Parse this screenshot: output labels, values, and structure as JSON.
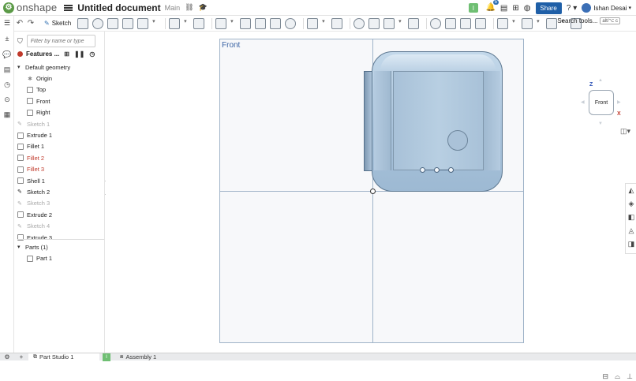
{
  "app": {
    "logo_mark": "⚙",
    "logo_text": "onshape",
    "document_title": "Untitled document",
    "branch": "Main",
    "notifications_count": "5",
    "notification_badge": "I",
    "share_label": "Share",
    "help_icon": "?",
    "user_name": "Ishan Desai"
  },
  "toolbar": {
    "sketch_label": "Sketch",
    "search_tools_label": "Search tools...",
    "search_tools_shortcut": "alt/⌥ c"
  },
  "feature_panel": {
    "filter_placeholder": "Filter by name or type",
    "header_label": "Features ...",
    "tree": [
      {
        "label": "Default geometry",
        "kind": "group",
        "state": "normal"
      },
      {
        "label": "Origin",
        "kind": "origin",
        "state": "normal"
      },
      {
        "label": "Top",
        "kind": "plane",
        "state": "normal"
      },
      {
        "label": "Front",
        "kind": "plane",
        "state": "normal"
      },
      {
        "label": "Right",
        "kind": "plane",
        "state": "normal"
      },
      {
        "label": "Sketch 1",
        "kind": "sketch",
        "state": "muted"
      },
      {
        "label": "Extrude 1",
        "kind": "feature",
        "state": "normal"
      },
      {
        "label": "Fillet 1",
        "kind": "feature",
        "state": "normal"
      },
      {
        "label": "Fillet 2",
        "kind": "feature",
        "state": "error"
      },
      {
        "label": "Fillet 3",
        "kind": "feature",
        "state": "error"
      },
      {
        "label": "Shell 1",
        "kind": "feature",
        "state": "normal"
      },
      {
        "label": "Sketch 2",
        "kind": "sketch",
        "state": "normal"
      },
      {
        "label": "Sketch 3",
        "kind": "sketch",
        "state": "muted"
      },
      {
        "label": "Extrude 2",
        "kind": "feature",
        "state": "normal"
      },
      {
        "label": "Sketch 4",
        "kind": "sketch",
        "state": "muted"
      },
      {
        "label": "Extrude 3",
        "kind": "feature",
        "state": "normal"
      }
    ],
    "parts_label": "Parts (1)",
    "parts": [
      "Part 1"
    ]
  },
  "viewport": {
    "plane_label": "Front",
    "view_cube_face": "Front",
    "axis_z": "Z",
    "axis_x": "X"
  },
  "tabs": [
    {
      "label": "Part Studio 1",
      "active": true
    },
    {
      "label": "Assembly 1",
      "active": false
    }
  ],
  "tab_badge": "I",
  "colors": {
    "accent": "#1f5fa7",
    "error": "#c0392b",
    "muted": "#a9a9a9",
    "plane_border": "#9fb3c8",
    "part_fill": "#a9c3db"
  }
}
